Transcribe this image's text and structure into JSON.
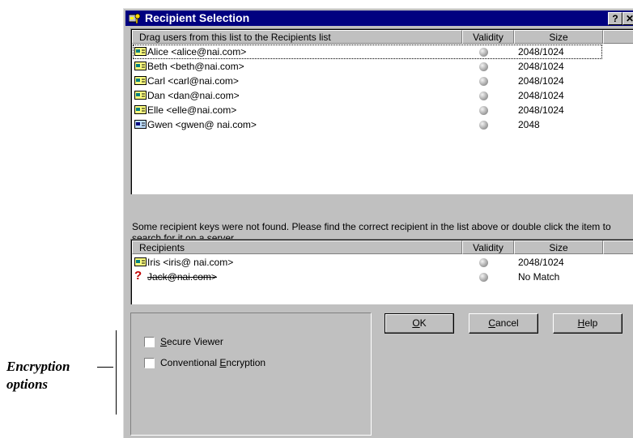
{
  "annotation": {
    "line1": "Encryption",
    "line2": "options"
  },
  "dialog": {
    "title": "Recipient Selection",
    "help_button": "?",
    "close_button": "✕"
  },
  "user_list": {
    "columns": {
      "name": "Drag users from this list to the Recipients list",
      "validity": "Validity",
      "size": "Size"
    },
    "rows": [
      {
        "name": "Alice <alice@nai.com>",
        "size": "2048/1024"
      },
      {
        "name": "Beth <beth@nai.com>",
        "size": "2048/1024"
      },
      {
        "name": "Carl <carl@nai.com>",
        "size": "2048/1024"
      },
      {
        "name": "Dan <dan@nai.com>",
        "size": "2048/1024"
      },
      {
        "name": "Elle <elle@nai.com>",
        "size": "2048/1024"
      },
      {
        "name": "Gwen <gwen@ nai.com>",
        "size": "2048"
      }
    ]
  },
  "message": "Some recipient keys were not found. Please find the correct recipient in the list above or double click the item to search for it on a server.",
  "recipients": {
    "columns": {
      "name": "Recipients",
      "validity": "Validity",
      "size": "Size"
    },
    "rows": [
      {
        "name": "Iris <iris@ nai.com>",
        "size": "2048/1024"
      },
      {
        "name": "Jack@nai.com>",
        "size": "No Match"
      }
    ]
  },
  "options": {
    "secure_viewer": {
      "pre": "",
      "mnemonic": "S",
      "post": "ecure Viewer",
      "checked": false
    },
    "conventional": {
      "pre": "Conventional ",
      "mnemonic": "E",
      "post": "ncryption",
      "checked": false
    }
  },
  "buttons": {
    "ok": {
      "mnemonic": "O",
      "rest": "K"
    },
    "cancel": {
      "mnemonic": "C",
      "rest": "ancel"
    },
    "help": {
      "mnemonic": "H",
      "rest": "elp"
    }
  },
  "colors": {
    "titlebar": "#000080",
    "face": "#c0c0c0",
    "missing_key": "#c00000"
  }
}
